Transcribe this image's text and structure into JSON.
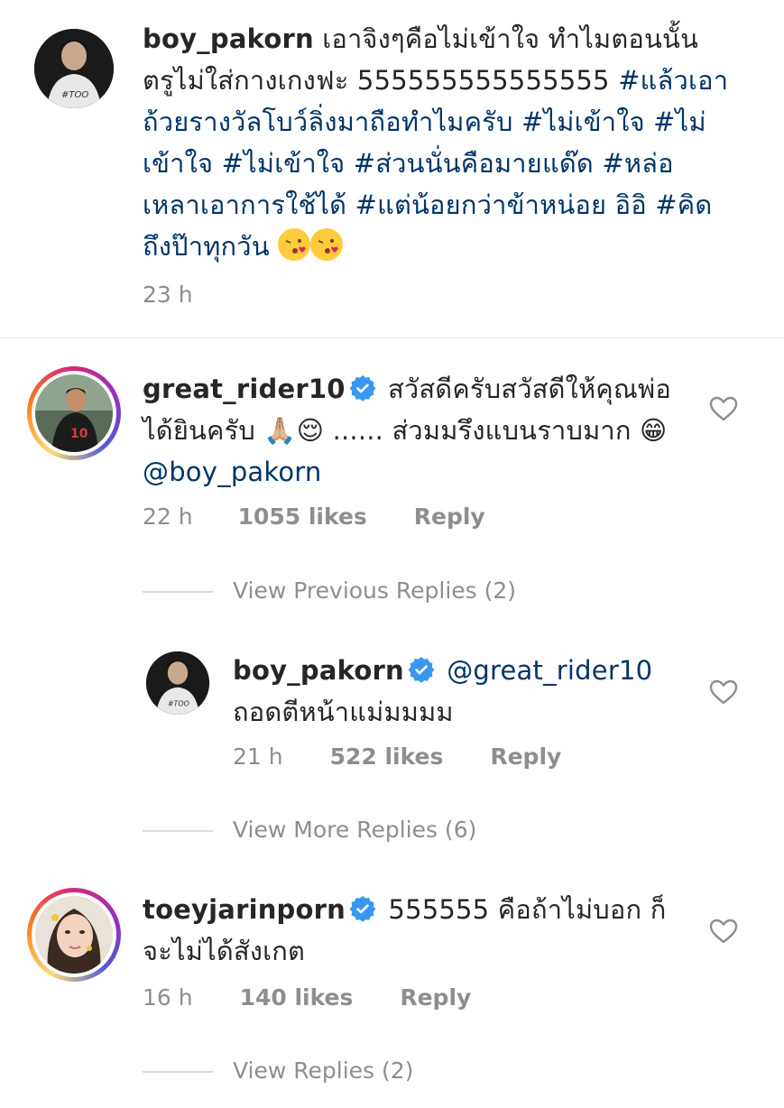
{
  "caption": {
    "username": "boy_pakorn",
    "text_plain": "เอาจิงๆคือไม่เข้าใจ ทำไมตอนนั้นตรูไม่ใส่กางเกงฟะ 555555555555555",
    "text_tags": "#แล้วเอาถ้วยรางวัลโบว์ลิ่งมาถือทำไมครับ #ไม่เข้าใจ #ไม่เข้าใจ #ไม่เข้าใจ #ส่วนนั่นคือมายแด๊ด #หล่อเหลาเอาการใช้ได้ #แต่น้อยกว่าข้าหน่อย อิอิ #คิดถึงป๊าทุกวัน",
    "time": "23 h"
  },
  "comments": [
    {
      "username": "great_rider10",
      "text": "สวัสดีครับสวัสดีให้คุณพ่อได้ยินครับ 🙏🏼😌 ...... ส่วมมรึงแบนราบมาก 😁",
      "mention": "@boy_pakorn",
      "time": "22 h",
      "likes": "1055 likes",
      "reply": "Reply",
      "view_previous": "View Previous Replies (2)",
      "view_more": "View More Replies (6)"
    },
    {
      "username": "boy_pakorn",
      "mention": "@great_rider10",
      "text": "ถอดตีหน้าแม่มมมม",
      "time": "21 h",
      "likes": "522 likes",
      "reply": "Reply"
    },
    {
      "username": "toeyjarinporn",
      "text": "555555 คือถ้าไม่บอก ก็จะไม่ได้สังเกต",
      "time": "16 h",
      "likes": "140 likes",
      "reply": "Reply",
      "view_replies": "View Replies (2)"
    }
  ],
  "icons": {
    "verified": "verified-badge-icon",
    "like": "heart-outline-icon"
  },
  "colors": {
    "hashtag": "#003569",
    "verified": "#3897f0",
    "muted": "#8e8e8e"
  }
}
